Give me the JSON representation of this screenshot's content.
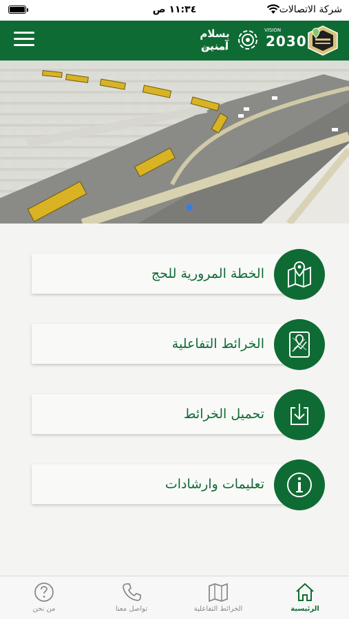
{
  "status_bar": {
    "carrier": "شركة الاتصالات",
    "time": "١١:٣٤ ص"
  },
  "header": {
    "salam_logo_name": "بسلام آمنين",
    "salam_logo_years": "2022 - 1990",
    "vision_label": "VISION",
    "vision_year": "2030"
  },
  "banner": {
    "alt": "banner-image",
    "active_page": 1,
    "page_count": 1
  },
  "menu": {
    "items": [
      {
        "label": "الخطة المرورية للحج",
        "icon": "map-pin-icon"
      },
      {
        "label": "الخرائط التفاعلية",
        "icon": "interactive-map-icon"
      },
      {
        "label": "تحميل الخرائط",
        "icon": "download-icon"
      },
      {
        "label": "تعليمات وارشادات",
        "icon": "info-icon"
      }
    ]
  },
  "tabbar": {
    "tabs": [
      {
        "label": "الرئيسية",
        "icon": "home-icon",
        "active": true
      },
      {
        "label": "الخرائط التفاعلية",
        "icon": "map-icon",
        "active": false
      },
      {
        "label": "تواصل معنا",
        "icon": "phone-icon",
        "active": false
      },
      {
        "label": "من نحن",
        "icon": "help-icon",
        "active": false
      }
    ]
  },
  "colors": {
    "primary": "#0f6b34",
    "tab_inactive": "#8a8a8a",
    "page_indicator": "#2f7cf6"
  }
}
